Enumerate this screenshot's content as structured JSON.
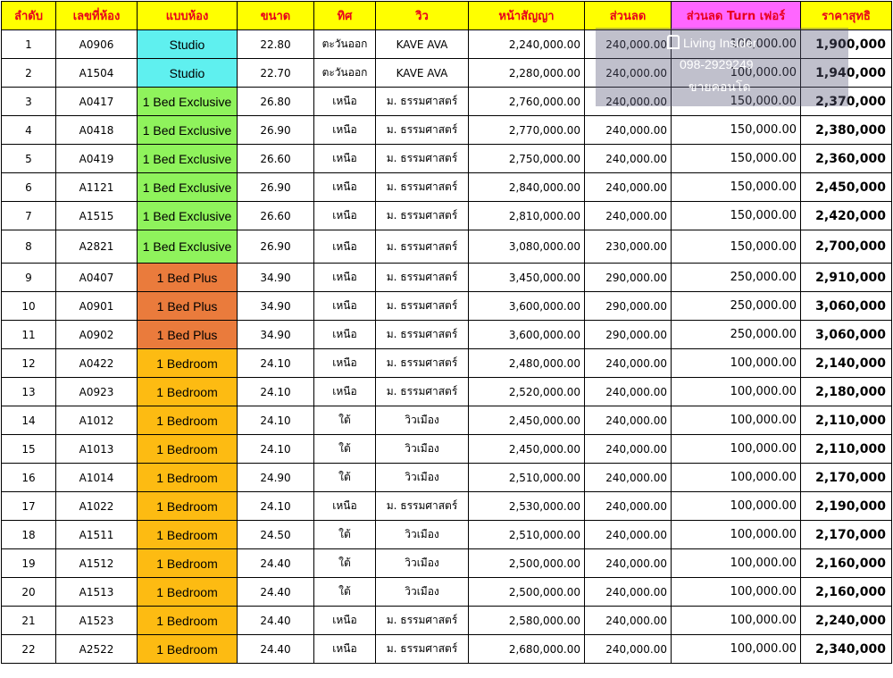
{
  "headers": [
    "ลำดับ",
    "เลขที่ห้อง",
    "แบบห้อง",
    "ขนาด",
    "ทิศ",
    "วิว",
    "หน้าสัญญา",
    "ส่วนลด",
    "ส่วนลด Turn เฟอร์",
    "ราคาสุทธิ"
  ],
  "colors": {
    "header_bg": "#ffff00",
    "header_text": "#e8001c",
    "turn_header_bg": "#ff66ff",
    "Studio": "#5ff0ef",
    "1 Bed Exclusive": "#8ff35c",
    "1 Bed Plus": "#ea7b3c",
    "1 Bedroom": "#fdbb12"
  },
  "watermark": {
    "brand": "Living Insider",
    "phone": "098-2929249",
    "tagline": "ขายคอนโด"
  },
  "rows": [
    {
      "no": "1",
      "unit": "A0906",
      "type": "Studio",
      "size": "22.80",
      "dir": "ตะวันออก",
      "view": "KAVE AVA",
      "contract": "2,240,000.00",
      "discount": "240,000.00",
      "turn": "100,000.00",
      "net": "1,900,000"
    },
    {
      "no": "2",
      "unit": "A1504",
      "type": "Studio",
      "size": "22.70",
      "dir": "ตะวันออก",
      "view": "KAVE AVA",
      "contract": "2,280,000.00",
      "discount": "240,000.00",
      "turn": "100,000.00",
      "net": "1,940,000"
    },
    {
      "no": "3",
      "unit": "A0417",
      "type": "1 Bed Exclusive",
      "size": "26.80",
      "dir": "เหนือ",
      "view": "ม. ธรรมศาสตร์",
      "contract": "2,760,000.00",
      "discount": "240,000.00",
      "turn": "150,000.00",
      "net": "2,370,000"
    },
    {
      "no": "4",
      "unit": "A0418",
      "type": "1 Bed Exclusive",
      "size": "26.90",
      "dir": "เหนือ",
      "view": "ม. ธรรมศาสตร์",
      "contract": "2,770,000.00",
      "discount": "240,000.00",
      "turn": "150,000.00",
      "net": "2,380,000"
    },
    {
      "no": "5",
      "unit": "A0419",
      "type": "1 Bed Exclusive",
      "size": "26.60",
      "dir": "เหนือ",
      "view": "ม. ธรรมศาสตร์",
      "contract": "2,750,000.00",
      "discount": "240,000.00",
      "turn": "150,000.00",
      "net": "2,360,000"
    },
    {
      "no": "6",
      "unit": "A1121",
      "type": "1 Bed Exclusive",
      "size": "26.90",
      "dir": "เหนือ",
      "view": "ม. ธรรมศาสตร์",
      "contract": "2,840,000.00",
      "discount": "240,000.00",
      "turn": "150,000.00",
      "net": "2,450,000"
    },
    {
      "no": "7",
      "unit": "A1515",
      "type": "1 Bed Exclusive",
      "size": "26.60",
      "dir": "เหนือ",
      "view": "ม. ธรรมศาสตร์",
      "contract": "2,810,000.00",
      "discount": "240,000.00",
      "turn": "150,000.00",
      "net": "2,420,000"
    },
    {
      "no": "8",
      "unit": "A2821",
      "type": "1 Bed Exclusive",
      "size": "26.90",
      "dir": "เหนือ",
      "view": "ม. ธรรมศาสตร์",
      "contract": "3,080,000.00",
      "discount": "230,000.00",
      "turn": "150,000.00",
      "net": "2,700,000"
    },
    {
      "no": "9",
      "unit": "A0407",
      "type": "1 Bed Plus",
      "size": "34.90",
      "dir": "เหนือ",
      "view": "ม. ธรรมศาสตร์",
      "contract": "3,450,000.00",
      "discount": "290,000.00",
      "turn": "250,000.00",
      "net": "2,910,000"
    },
    {
      "no": "10",
      "unit": "A0901",
      "type": "1 Bed Plus",
      "size": "34.90",
      "dir": "เหนือ",
      "view": "ม. ธรรมศาสตร์",
      "contract": "3,600,000.00",
      "discount": "290,000.00",
      "turn": "250,000.00",
      "net": "3,060,000"
    },
    {
      "no": "11",
      "unit": "A0902",
      "type": "1 Bed Plus",
      "size": "34.90",
      "dir": "เหนือ",
      "view": "ม. ธรรมศาสตร์",
      "contract": "3,600,000.00",
      "discount": "290,000.00",
      "turn": "250,000.00",
      "net": "3,060,000"
    },
    {
      "no": "12",
      "unit": "A0422",
      "type": "1 Bedroom",
      "size": "24.10",
      "dir": "เหนือ",
      "view": "ม. ธรรมศาสตร์",
      "contract": "2,480,000.00",
      "discount": "240,000.00",
      "turn": "100,000.00",
      "net": "2,140,000"
    },
    {
      "no": "13",
      "unit": "A0923",
      "type": "1 Bedroom",
      "size": "24.10",
      "dir": "เหนือ",
      "view": "ม. ธรรมศาสตร์",
      "contract": "2,520,000.00",
      "discount": "240,000.00",
      "turn": "100,000.00",
      "net": "2,180,000"
    },
    {
      "no": "14",
      "unit": "A1012",
      "type": "1 Bedroom",
      "size": "24.10",
      "dir": "ใต้",
      "view": "วิวเมือง",
      "contract": "2,450,000.00",
      "discount": "240,000.00",
      "turn": "100,000.00",
      "net": "2,110,000"
    },
    {
      "no": "15",
      "unit": "A1013",
      "type": "1 Bedroom",
      "size": "24.10",
      "dir": "ใต้",
      "view": "วิวเมือง",
      "contract": "2,450,000.00",
      "discount": "240,000.00",
      "turn": "100,000.00",
      "net": "2,110,000"
    },
    {
      "no": "16",
      "unit": "A1014",
      "type": "1 Bedroom",
      "size": "24.90",
      "dir": "ใต้",
      "view": "วิวเมือง",
      "contract": "2,510,000.00",
      "discount": "240,000.00",
      "turn": "100,000.00",
      "net": "2,170,000"
    },
    {
      "no": "17",
      "unit": "A1022",
      "type": "1 Bedroom",
      "size": "24.10",
      "dir": "เหนือ",
      "view": "ม. ธรรมศาสตร์",
      "contract": "2,530,000.00",
      "discount": "240,000.00",
      "turn": "100,000.00",
      "net": "2,190,000"
    },
    {
      "no": "18",
      "unit": "A1511",
      "type": "1 Bedroom",
      "size": "24.50",
      "dir": "ใต้",
      "view": "วิวเมือง",
      "contract": "2,510,000.00",
      "discount": "240,000.00",
      "turn": "100,000.00",
      "net": "2,170,000"
    },
    {
      "no": "19",
      "unit": "A1512",
      "type": "1 Bedroom",
      "size": "24.40",
      "dir": "ใต้",
      "view": "วิวเมือง",
      "contract": "2,500,000.00",
      "discount": "240,000.00",
      "turn": "100,000.00",
      "net": "2,160,000"
    },
    {
      "no": "20",
      "unit": "A1513",
      "type": "1 Bedroom",
      "size": "24.40",
      "dir": "ใต้",
      "view": "วิวเมือง",
      "contract": "2,500,000.00",
      "discount": "240,000.00",
      "turn": "100,000.00",
      "net": "2,160,000"
    },
    {
      "no": "21",
      "unit": "A1523",
      "type": "1 Bedroom",
      "size": "24.40",
      "dir": "เหนือ",
      "view": "ม. ธรรมศาสตร์",
      "contract": "2,580,000.00",
      "discount": "240,000.00",
      "turn": "100,000.00",
      "net": "2,240,000"
    },
    {
      "no": "22",
      "unit": "A2522",
      "type": "1 Bedroom",
      "size": "24.40",
      "dir": "เหนือ",
      "view": "ม. ธรรมศาสตร์",
      "contract": "2,680,000.00",
      "discount": "240,000.00",
      "turn": "100,000.00",
      "net": "2,340,000"
    }
  ]
}
